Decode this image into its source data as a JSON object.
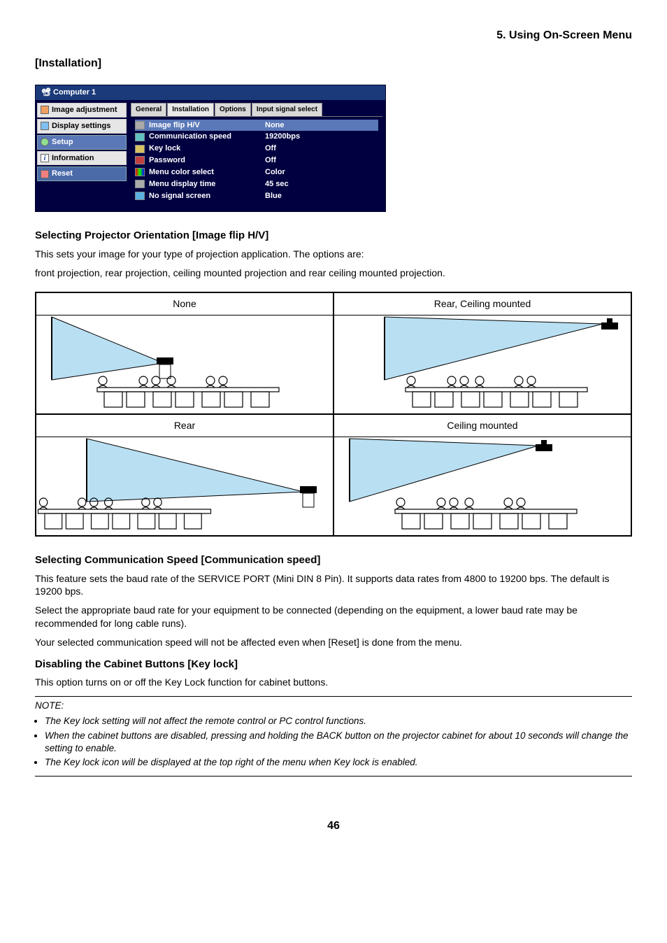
{
  "header": {
    "chapter": "5. Using On-Screen Menu"
  },
  "section": {
    "title": "[Installation]"
  },
  "menu": {
    "title": "Computer 1",
    "left_items": [
      {
        "label": "Image adjustment"
      },
      {
        "label": "Display settings"
      },
      {
        "label": "Setup"
      },
      {
        "label": "Information"
      },
      {
        "label": "Reset"
      }
    ],
    "tabs": [
      {
        "label": "General"
      },
      {
        "label": "Installation"
      },
      {
        "label": "Options"
      },
      {
        "label": "Input signal select"
      }
    ],
    "rows": [
      {
        "label": "Image flip H/V",
        "value": "None"
      },
      {
        "label": "Communication speed",
        "value": "19200bps"
      },
      {
        "label": "Key lock",
        "value": "Off"
      },
      {
        "label": "Password",
        "value": "Off"
      },
      {
        "label": "Menu color select",
        "value": "Color"
      },
      {
        "label": "Menu display time",
        "value": "45 sec"
      },
      {
        "label": "No signal screen",
        "value": "Blue"
      }
    ]
  },
  "sections": {
    "imageflip": {
      "heading": "Selecting Projector Orientation [Image flip H/V]",
      "p1": "This sets your image for your type of projection application. The options are:",
      "p2": "front projection, rear projection, ceiling mounted projection and rear ceiling mounted projection.",
      "captions": {
        "none": "None",
        "rear_ceiling": "Rear, Ceiling mounted",
        "rear": "Rear",
        "ceiling": "Ceiling mounted"
      }
    },
    "commspeed": {
      "heading": "Selecting Communication Speed [Communication speed]",
      "p1": "This feature sets the baud rate of the SERVICE PORT (Mini DIN 8 Pin). It supports data rates from 4800 to 19200 bps. The default is 19200 bps.",
      "p2": "Select the appropriate baud rate for your equipment to be connected (depending on the equipment, a lower baud rate may be recommended for long cable runs).",
      "p3": "Your selected communication speed will not be affected even when [Reset] is done from the menu."
    },
    "keylock": {
      "heading": "Disabling the Cabinet Buttons [Key lock]",
      "p1": "This option turns on or off the Key Lock function for cabinet buttons.",
      "note_label": "NOTE:",
      "notes": [
        "The Key lock setting will not affect the remote control or PC control functions.",
        "When the cabinet buttons are disabled, pressing and holding the BACK button on the projector cabinet for about 10 seconds will change the setting to enable.",
        "The Key lock icon will be displayed at the top right of the menu when Key lock is enabled."
      ]
    }
  },
  "page_number": "46"
}
